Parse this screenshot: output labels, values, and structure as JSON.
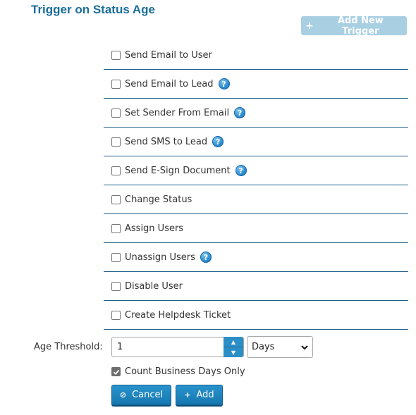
{
  "header": {
    "title": "Trigger on Status Age",
    "add_trigger_label": "Add New Trigger",
    "add_trigger_icon": "plus-icon"
  },
  "actions": [
    {
      "label": "Send Email to User",
      "checked": false,
      "help": false
    },
    {
      "label": "Send Email to Lead",
      "checked": false,
      "help": true
    },
    {
      "label": "Set Sender From Email",
      "checked": false,
      "help": true
    },
    {
      "label": "Send SMS to Lead",
      "checked": false,
      "help": true
    },
    {
      "label": "Send E-Sign Document",
      "checked": false,
      "help": true
    },
    {
      "label": "Change Status",
      "checked": false,
      "help": false
    },
    {
      "label": "Assign Users",
      "checked": false,
      "help": false
    },
    {
      "label": "Unassign Users",
      "checked": false,
      "help": true
    },
    {
      "label": "Disable User",
      "checked": false,
      "help": false
    },
    {
      "label": "Create Helpdesk Ticket",
      "checked": false,
      "help": false
    }
  ],
  "threshold": {
    "label": "Age Threshold:",
    "value": "1",
    "unit": "Days"
  },
  "business_days": {
    "label": "Count Business Days Only",
    "checked": true
  },
  "buttons": {
    "cancel": "Cancel",
    "add": "Add"
  },
  "colors": {
    "title": "#1a6e99",
    "divider": "#1f5f8a",
    "primary_button": "#1f86bf",
    "disabled_button": "#a9cfe3"
  }
}
